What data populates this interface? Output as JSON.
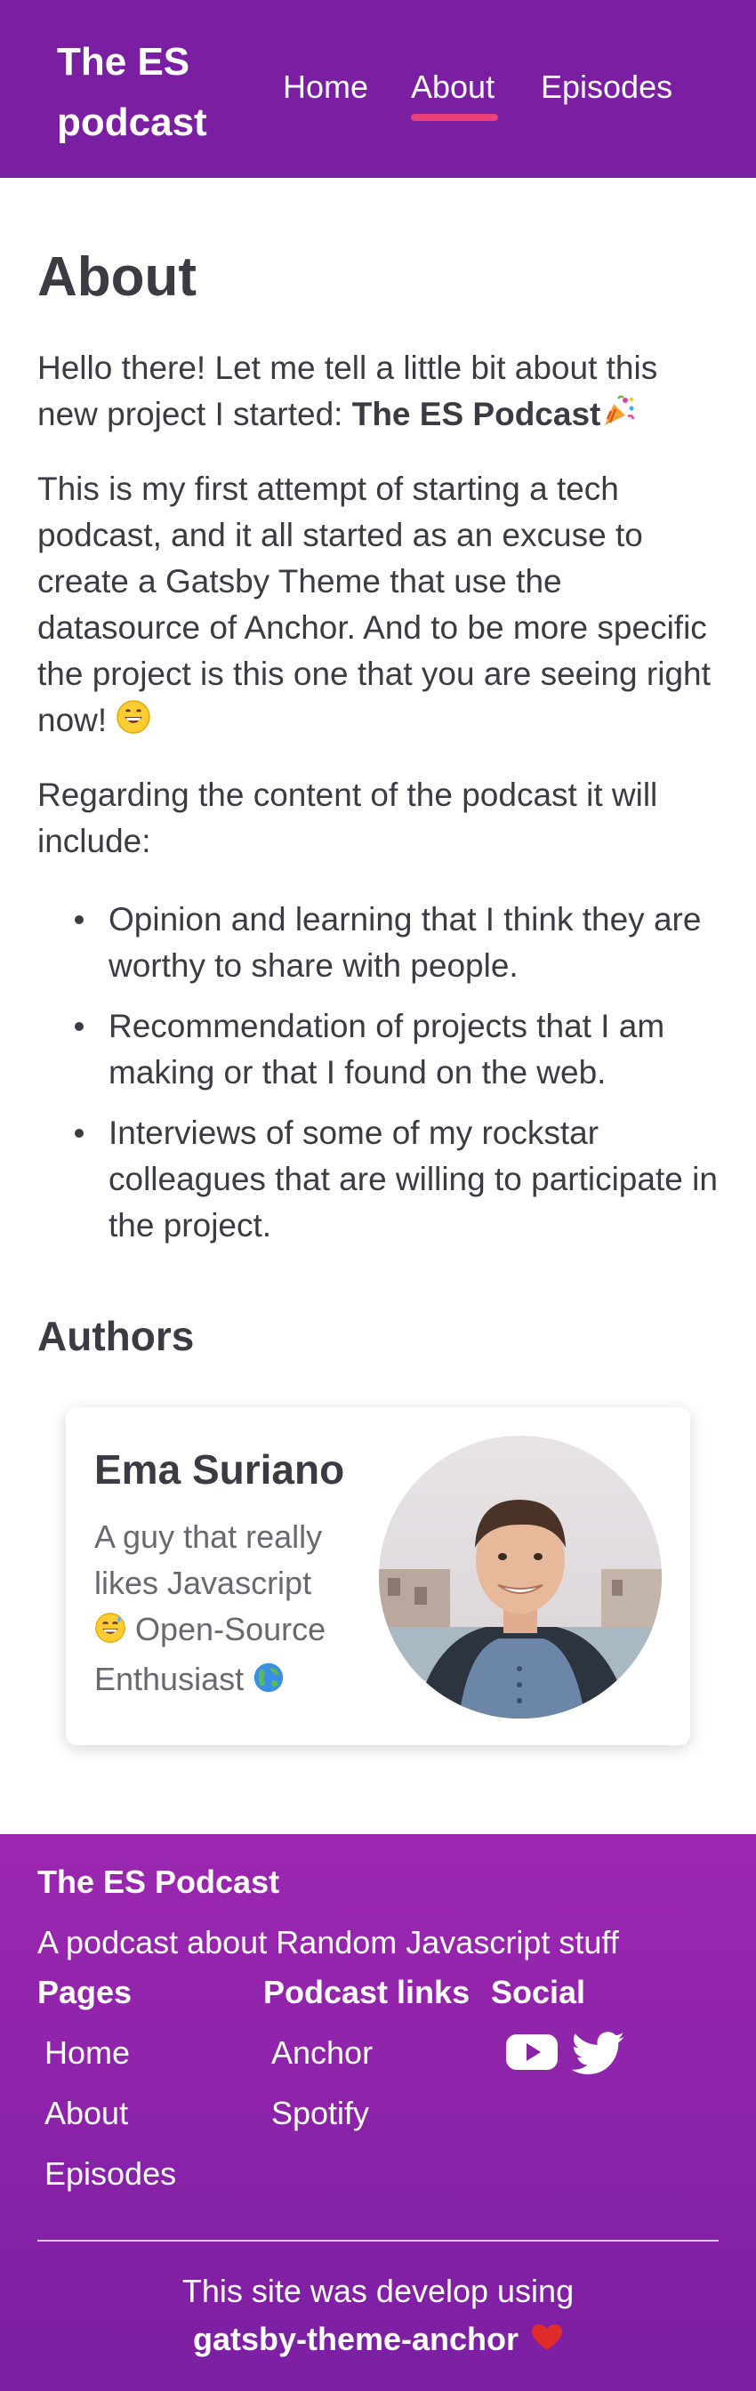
{
  "header": {
    "logo_line1": "The ES",
    "logo_line2": "podcast",
    "nav": [
      "Home",
      "About",
      "Episodes"
    ],
    "active_nav": "About",
    "colors": {
      "header_bg": "#7b1fa2",
      "active_underline": "#ec407a"
    }
  },
  "main": {
    "title": "About",
    "intro_text": "Hello there! Let me tell a little bit about this new project I started: ",
    "intro_strong": "The ES Podcast",
    "intro_emoji": "party-popper-icon",
    "paragraph2": "This is my first attempt of starting a tech podcast, and it all started as an excuse to create a Gatsby Theme that use the datasource of Anchor. And to be more specific the project is this one that you are seeing right now!",
    "paragraph2_emoji": "grinning-face-icon",
    "paragraph3": "Regarding the content of the podcast it will include:",
    "list": [
      "Opinion and learning that I think they are worthy to share with people.",
      "Recommendation of projects that I am making or that I found on the web.",
      "Interviews of some of my rockstar colleagues that are willing to participate in the project."
    ],
    "authors_title": "Authors",
    "author": {
      "name": "Ema Suriano",
      "bio_part1": "A guy that really likes Javascript",
      "bio_emoji1": "sweat-smile-icon",
      "bio_part2": "Open-Source Enthusiast",
      "bio_emoji2": "globe-icon"
    }
  },
  "footer": {
    "title": "The ES Podcast",
    "description": "A podcast about Random Javascript stuff",
    "pages_heading": "Pages",
    "pages": [
      "Home",
      "About",
      "Episodes"
    ],
    "links_heading": "Podcast links",
    "links": [
      "Anchor",
      "Spotify"
    ],
    "social_heading": "Social",
    "social_icons": [
      "youtube-icon",
      "twitter-icon"
    ],
    "credit_line1": "This site was develop using",
    "credit_line2": "gatsby-theme-anchor",
    "credit_icon": "heart-icon",
    "colors": {
      "footer_bg_top": "#9c27b0",
      "footer_bg_bottom": "#7b1fa2"
    }
  }
}
